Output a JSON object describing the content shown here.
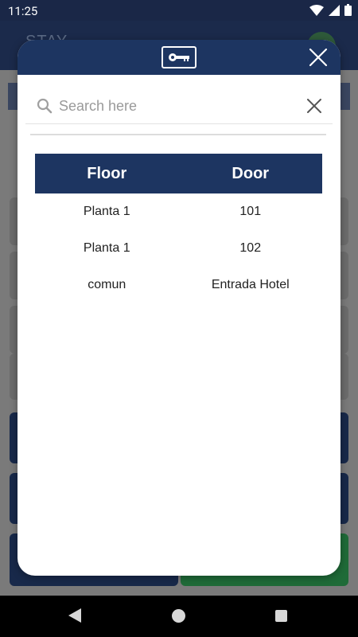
{
  "status_bar": {
    "time": "11:25",
    "icons": [
      "wifi-icon",
      "signal-icon",
      "battery-icon"
    ]
  },
  "background_app": {
    "header_title": "STAY"
  },
  "modal": {
    "header_icon": "key-icon",
    "close_icon": "close-icon",
    "search": {
      "placeholder": "Search here",
      "value": ""
    },
    "table": {
      "columns": [
        "Floor",
        "Door"
      ],
      "rows": [
        [
          "Planta 1",
          "101"
        ],
        [
          "Planta 1",
          "102"
        ],
        [
          "comun",
          "Entrada Hotel"
        ]
      ]
    }
  },
  "nav_bar": {
    "icons": [
      "back-icon",
      "home-icon",
      "recents-icon"
    ]
  },
  "colors": {
    "primary_navy": "#1d3561",
    "status_bar": "#1a2747",
    "background_dim": "#7a7a7a"
  }
}
